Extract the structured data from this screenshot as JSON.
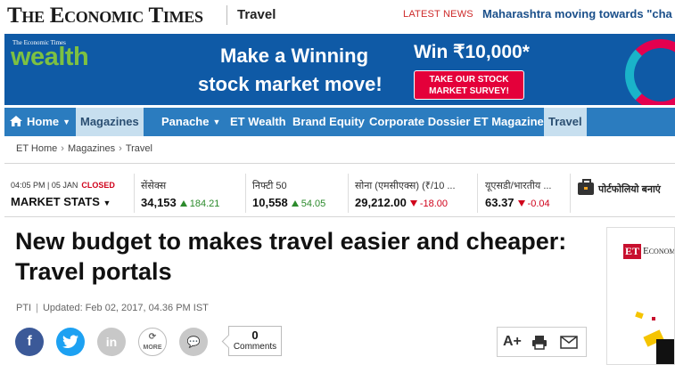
{
  "header": {
    "logo": "The Economic Times",
    "section": "Travel",
    "latest_label": "LATEST NEWS",
    "latest_text": "Maharashtra moving towards \"cha"
  },
  "banner": {
    "logo_small": "The Economic Times",
    "logo_big": "wealth",
    "line1": "Make a Winning",
    "line2": "stock market move!",
    "win": "Win ₹10,000*",
    "cta_line1": "TAKE OUR STOCK",
    "cta_line2": "MARKET SURVEY!",
    "colors": {
      "background": "#0f5aa6",
      "cta": "#e4003a",
      "logo": "#7dc142"
    }
  },
  "nav": {
    "items": [
      {
        "label": "Home",
        "has_dropdown": true
      },
      {
        "label": "Magazines",
        "has_dropdown": false,
        "active": true
      },
      {
        "label": "Panache",
        "has_dropdown": true
      },
      {
        "label": "ET Wealth",
        "has_dropdown": false
      },
      {
        "label": "Brand Equity",
        "has_dropdown": false
      },
      {
        "label": "Corporate Dossier",
        "has_dropdown": false
      },
      {
        "label": "ET Magazine",
        "has_dropdown": false
      },
      {
        "label": "Travel",
        "has_dropdown": false,
        "active": true
      }
    ],
    "colors": {
      "bar": "#2b7cbf",
      "active": "#c7dfef"
    }
  },
  "breadcrumb": [
    "ET Home",
    "Magazines",
    "Travel"
  ],
  "market": {
    "time": "04:05 PM | 05 JAN",
    "status": "CLOSED",
    "stats_label": "MARKET STATS",
    "columns": [
      {
        "name": "सेंसेक्स",
        "value": "34,153",
        "change": "184.21",
        "direction": "up"
      },
      {
        "name": "निफ्टी 50",
        "value": "10,558",
        "change": "54.05",
        "direction": "up"
      },
      {
        "name": "सोना (एमसीएक्स) (₹/10 ...",
        "value": "29,212.00",
        "change": "-18.00",
        "direction": "down"
      },
      {
        "name": "यूएसडी/भारतीय ...",
        "value": "63.37",
        "change": "-0.04",
        "direction": "down"
      }
    ],
    "portfolio_label": "पोर्टफोलियो बनाएं"
  },
  "article": {
    "headline": "New budget to makes travel easier and cheaper: Travel portals",
    "source": "PTI",
    "updated": "Updated: Feb 02, 2017, 04.36 PM IST"
  },
  "share": {
    "more_label": "MORE",
    "comments_count": "0",
    "comments_label": "Comments"
  },
  "tools": {
    "font_size_label": "A+"
  },
  "side_ad": {
    "et_badge": "ET",
    "brand_text": "Economic"
  }
}
